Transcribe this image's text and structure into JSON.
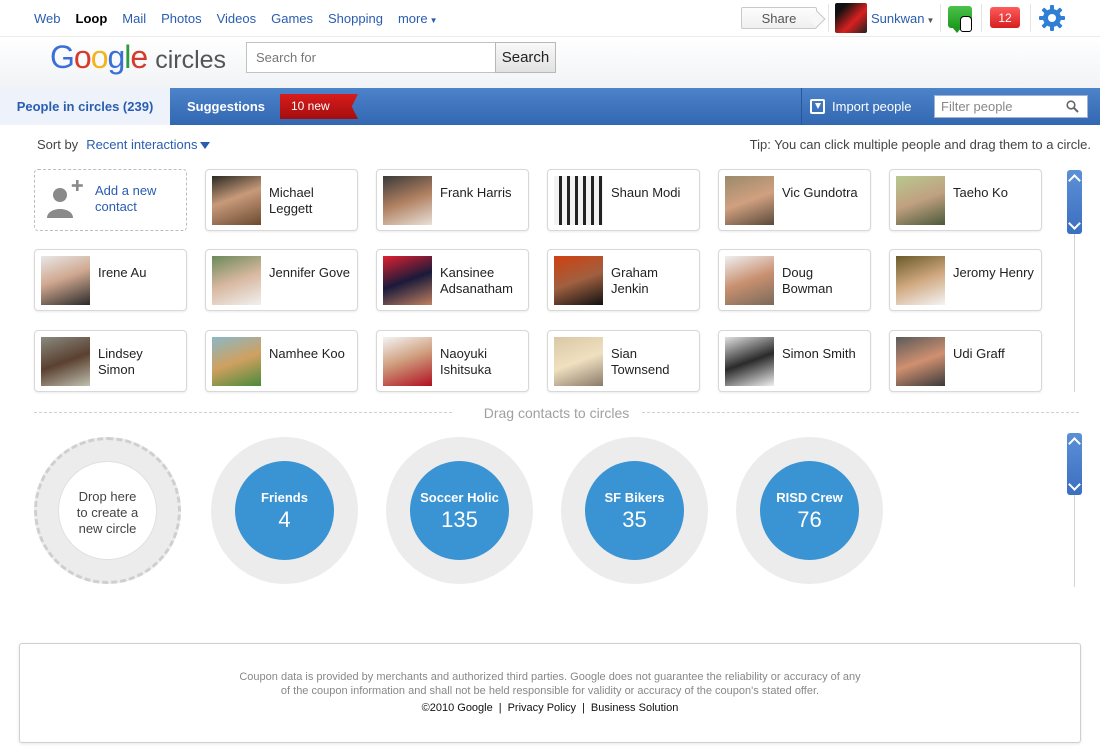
{
  "topnav": {
    "items": [
      {
        "label": "Web",
        "active": false
      },
      {
        "label": "Loop",
        "active": true
      },
      {
        "label": "Mail",
        "active": false
      },
      {
        "label": "Photos",
        "active": false
      },
      {
        "label": "Videos",
        "active": false
      },
      {
        "label": "Games",
        "active": false
      },
      {
        "label": "Shopping",
        "active": false
      },
      {
        "label": "more",
        "active": false
      }
    ],
    "share_label": "Share",
    "user_name": "Sunkwan",
    "notification_count": "12"
  },
  "header": {
    "logo_word": "Google",
    "product": "circles",
    "search_placeholder": "Search for",
    "search_button": "Search"
  },
  "tabs": {
    "people_in_circles": "People in circles (239)",
    "suggestions": "Suggestions",
    "new_badge": "10 new",
    "import_label": "Import people",
    "filter_placeholder": "Filter people"
  },
  "sort": {
    "label": "Sort by",
    "value": "Recent interactions",
    "tip": "Tip: You can click multiple people and drag them to a circle."
  },
  "add_contact": {
    "line1": "Add a new",
    "line2": "contact"
  },
  "people": [
    {
      "name": "Michael Leggett"
    },
    {
      "name": "Frank Harris"
    },
    {
      "name": "Shaun Modi"
    },
    {
      "name": "Vic Gundotra"
    },
    {
      "name": "Taeho Ko"
    },
    {
      "name": "Irene Au"
    },
    {
      "name": "Jennifer Gove"
    },
    {
      "name": "Kansinee Adsanatham"
    },
    {
      "name": "Graham Jenkin"
    },
    {
      "name": "Doug Bowman"
    },
    {
      "name": "Jeromy Henry"
    },
    {
      "name": "Lindsey Simon"
    },
    {
      "name": "Namhee Koo"
    },
    {
      "name": "Naoyuki Ishitsuka"
    },
    {
      "name": "Sian Townsend"
    },
    {
      "name": "Simon Smith"
    },
    {
      "name": "Udi Graff"
    }
  ],
  "drag_label": "Drag contacts to circles",
  "drop_zone": {
    "line1": "Drop here",
    "line2": "to create a",
    "line3": "new circle"
  },
  "circles": [
    {
      "name": "Friends",
      "count": "4"
    },
    {
      "name": "Soccer Holic",
      "count": "135"
    },
    {
      "name": "SF Bikers",
      "count": "35"
    },
    {
      "name": "RISD Crew",
      "count": "76"
    }
  ],
  "footer": {
    "disclaimer_line1": "Coupon data is provided by merchants and authorized third parties. Google does not guarantee the reliability or accuracy of any",
    "disclaimer_line2": "of the coupon information and shall not be held responsible for validity or accuracy of the coupon's stated offer.",
    "copyright": "©2010 Google",
    "privacy": "Privacy Policy",
    "business": "Business Solution"
  },
  "colors": {
    "accent_blue": "#3267b2",
    "circle_blue": "#3a93d2",
    "badge_red": "#d81c1c",
    "link_blue": "#2a5db0"
  }
}
